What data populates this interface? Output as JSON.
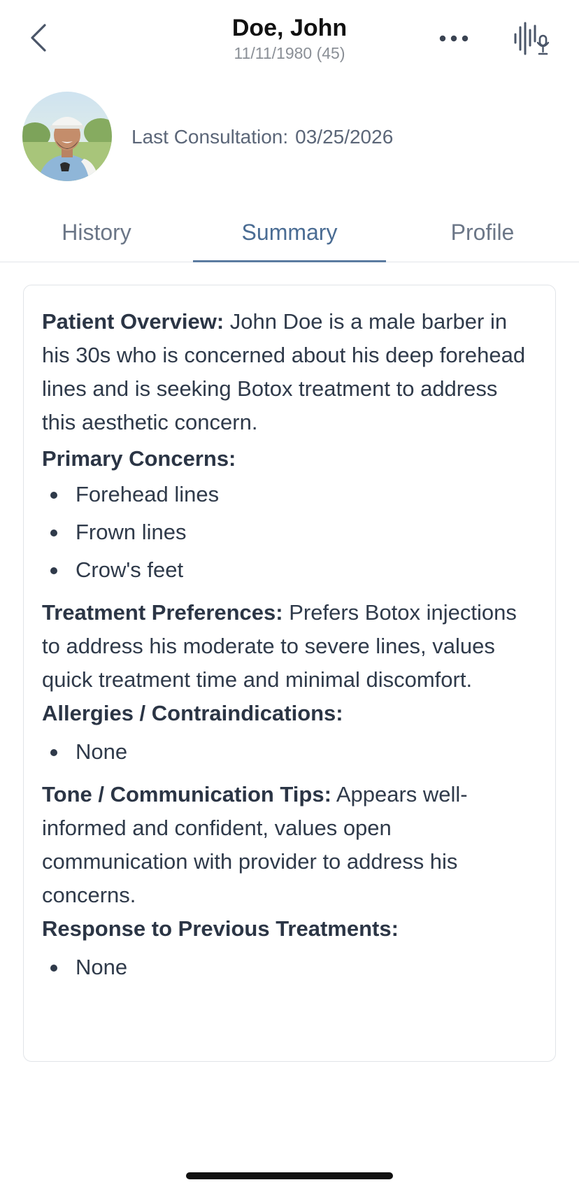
{
  "header": {
    "name": "Doe, John",
    "dob": "11/11/1980 (45)",
    "icons": {
      "back": "chevron-left-icon",
      "more": "more-horizontal-icon",
      "voice": "voice-waveform-mic-icon"
    }
  },
  "profile": {
    "consultation_label": "Last Consultation:",
    "consultation_date": "03/25/2026"
  },
  "tabs": [
    {
      "label": "History"
    },
    {
      "label": "Summary"
    },
    {
      "label": "Profile"
    }
  ],
  "active_tab": "Summary",
  "summary": {
    "overview_label": "Patient Overview:",
    "overview_text": "John Doe is a male barber in his 30s who is concerned about his deep forehead lines and is seeking Botox treatment to address this aesthetic concern.",
    "concerns_label": "Primary Concerns:",
    "concerns": [
      "Forehead lines",
      "Frown lines",
      "Crow's feet"
    ],
    "preferences_label": "Treatment Preferences:",
    "preferences_text": "Prefers Botox injections to address his moderate to severe lines, values quick treatment time and minimal discomfort.",
    "allergies_label": "Allergies / Contraindications:",
    "allergies": [
      "None"
    ],
    "tone_label": "Tone / Communication Tips:",
    "tone_text": "Appears well-informed and confident, values open communication with provider to address his concerns.",
    "previous_label": "Response to Previous Treatments:",
    "previous": [
      "None"
    ]
  },
  "colors": {
    "accent": "#5b7ba0",
    "active_tab_text": "#4a6c93",
    "inactive_tab_text": "#6b7687",
    "body_text": "#2f3a4a",
    "muted_text": "#8a8f96"
  }
}
